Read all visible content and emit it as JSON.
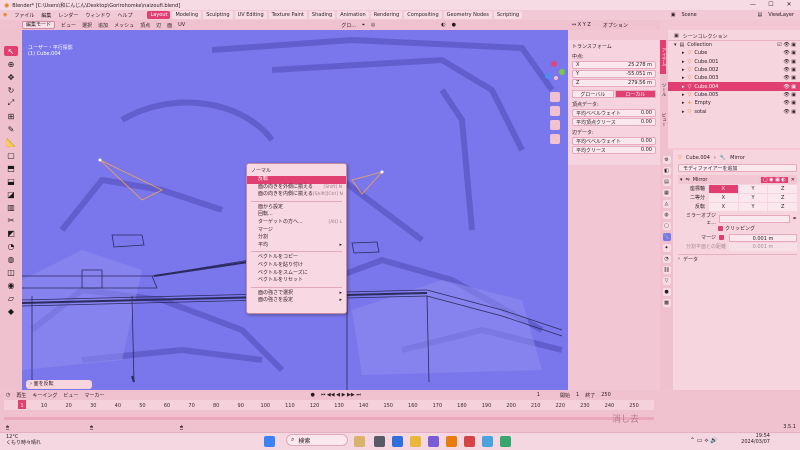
{
  "titlebar": {
    "title": "Blender* [C:\\Users\\和にんじん\\Desktop\\Gorirohomke\\naizoufi.blend]",
    "minimize": "—",
    "maximize": "☐",
    "close": "✕"
  },
  "menubar": {
    "items": [
      "ファイル",
      "編集",
      "レンダー",
      "ウィンドウ",
      "ヘルプ"
    ],
    "workspaces": [
      "Layout",
      "Modeling",
      "Sculpting",
      "UV Editing",
      "Texture Paint",
      "Shading",
      "Animation",
      "Rendering",
      "Compositing",
      "Geometry Nodes",
      "Scripting"
    ],
    "active_workspace": "Layout",
    "scene": "Scene",
    "view_layer": "ViewLayer"
  },
  "header": {
    "mode": "編集モード",
    "items": [
      "ビュー",
      "選択",
      "追加",
      "メッシュ",
      "頂点",
      "辺",
      "面",
      "UV"
    ],
    "transform": "グロ...",
    "options": "オプション"
  },
  "viewport": {
    "info1": "ユーザー・平行投影",
    "info2": "(1) Cube.004",
    "bg_color": "#7a77ec"
  },
  "npanel": {
    "title": "トランスフォーム",
    "median_label": "中点:",
    "x_label": "X",
    "x": "25.278 m",
    "y_label": "Y",
    "y": "-55.051 m",
    "z_label": "Z",
    "z": "279.56 m",
    "global": "グローバル",
    "local": "ローカル",
    "vertex_data": "頂点データ:",
    "vertex_bevel": "平均ベベルウェイト",
    "vertex_bevel_val": "0.00",
    "vertex_crease": "平均頂点クリース",
    "vertex_crease_val": "0.00",
    "edge_data": "辺データ:",
    "edge_bevel": "平均ベベルウェイト",
    "edge_bevel_val": "0.00",
    "edge_crease": "平均クリース",
    "edge_crease_val": "0.00",
    "side_tabs": [
      "アイテム",
      "ツール",
      "ビュー"
    ]
  },
  "context_menu": {
    "title": "ノーマル",
    "items": [
      {
        "label": "反転",
        "shortcut": "",
        "sub": false,
        "highlight": true
      },
      {
        "label": "面の向きを外側に揃える",
        "shortcut": "[Shift] N",
        "sub": false
      },
      {
        "label": "面の向きを内側に揃える",
        "shortcut": "[Shift][Ctrl] N",
        "sub": false
      },
      {
        "sep": true
      },
      {
        "label": "面から設定",
        "shortcut": "",
        "sub": false
      },
      {
        "label": "回転...",
        "shortcut": "",
        "sub": false
      },
      {
        "label": "ターゲットの方へ...",
        "shortcut": "[Alt] L",
        "sub": false
      },
      {
        "label": "マージ",
        "shortcut": "",
        "sub": false
      },
      {
        "label": "分割",
        "shortcut": "",
        "sub": false
      },
      {
        "label": "平均",
        "shortcut": "",
        "sub": true
      },
      {
        "sep": true
      },
      {
        "label": "ベクトルをコピー",
        "shortcut": "",
        "sub": false
      },
      {
        "label": "ベクトルを貼り付け",
        "shortcut": "",
        "sub": false
      },
      {
        "label": "ベクトルをスムーズに",
        "shortcut": "",
        "sub": false
      },
      {
        "label": "ベクトルをリセット",
        "shortcut": "",
        "sub": false
      },
      {
        "sep": true
      },
      {
        "label": "面の強さで選択",
        "shortcut": "",
        "sub": true
      },
      {
        "label": "面の強さを設定",
        "shortcut": "",
        "sub": true
      }
    ]
  },
  "outliner": {
    "title": "シーンコレクション",
    "items": [
      {
        "name": "Collection",
        "depth": 0,
        "selected": false
      },
      {
        "name": "Cube",
        "depth": 1,
        "selected": false
      },
      {
        "name": "Cube.001",
        "depth": 1,
        "selected": false
      },
      {
        "name": "Cube.002",
        "depth": 1,
        "selected": false
      },
      {
        "name": "Cube.003",
        "depth": 1,
        "selected": false
      },
      {
        "name": "Cube.004",
        "depth": 1,
        "selected": true
      },
      {
        "name": "Cube.005",
        "depth": 1,
        "selected": false
      },
      {
        "name": "Empty",
        "depth": 1,
        "selected": false
      },
      {
        "name": "sotai",
        "depth": 1,
        "selected": false
      }
    ]
  },
  "properties": {
    "object": "Cube.004",
    "modifier_type": "Mirror",
    "add_modifier": "モディファイアーを追加",
    "mod_name": "Mirror",
    "axis_label": "座標軸",
    "bisect_label": "二等分",
    "flip_label": "反転",
    "x": "X",
    "y": "Y",
    "z": "Z",
    "mirror_object": "ミラーオブジェ...",
    "clipping": "クリッピング",
    "merge": "マージ",
    "merge_val": "0.001 m",
    "bisect_dist": "分割平面との距離",
    "bisect_dist_val": "0.001 m",
    "data": "データ"
  },
  "timeline": {
    "items": [
      "再生",
      "キーイング",
      "ビュー",
      "マーカー"
    ],
    "current_frame": "1",
    "start_label": "開始",
    "start": "1",
    "end_label": "終了",
    "end": "250",
    "ticks": [
      "1",
      "10",
      "20",
      "30",
      "40",
      "50",
      "60",
      "70",
      "80",
      "90",
      "100",
      "110",
      "120",
      "130",
      "140",
      "150",
      "160",
      "170",
      "180",
      "190",
      "200",
      "210",
      "220",
      "230",
      "240",
      "250"
    ]
  },
  "undo_panel": "面を反転",
  "status": {
    "version": "3.5.1"
  },
  "taskbar": {
    "temp": "12°C",
    "weather": "くもり時々晴れ",
    "search": "検索",
    "time": "19:54",
    "date": "2024/03/07"
  },
  "watermark": "消し去"
}
